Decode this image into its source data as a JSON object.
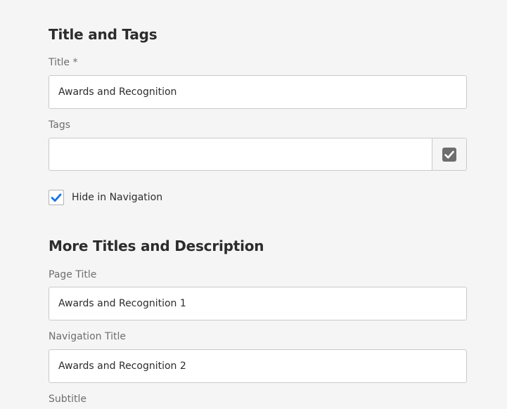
{
  "sections": {
    "title_and_tags": "Title and Tags",
    "more_titles": "More Titles and Description"
  },
  "fields": {
    "title": {
      "label": "Title *",
      "value": "Awards and Recognition"
    },
    "tags": {
      "label": "Tags",
      "value": ""
    },
    "hide_in_navigation": {
      "label": "Hide in Navigation",
      "checked": true
    },
    "page_title": {
      "label": "Page Title",
      "value": "Awards and Recognition 1"
    },
    "navigation_title": {
      "label": "Navigation Title",
      "value": "Awards and Recognition 2"
    },
    "subtitle": {
      "label": "Subtitle"
    }
  },
  "icons": {
    "tags_picker": "checklist-icon",
    "checkbox_mark": "checkmark-icon"
  },
  "colors": {
    "background": "#f5f5f5",
    "accent_blue": "#1473e6",
    "icon_gray": "#6e6e6e",
    "border": "#cacaca"
  }
}
